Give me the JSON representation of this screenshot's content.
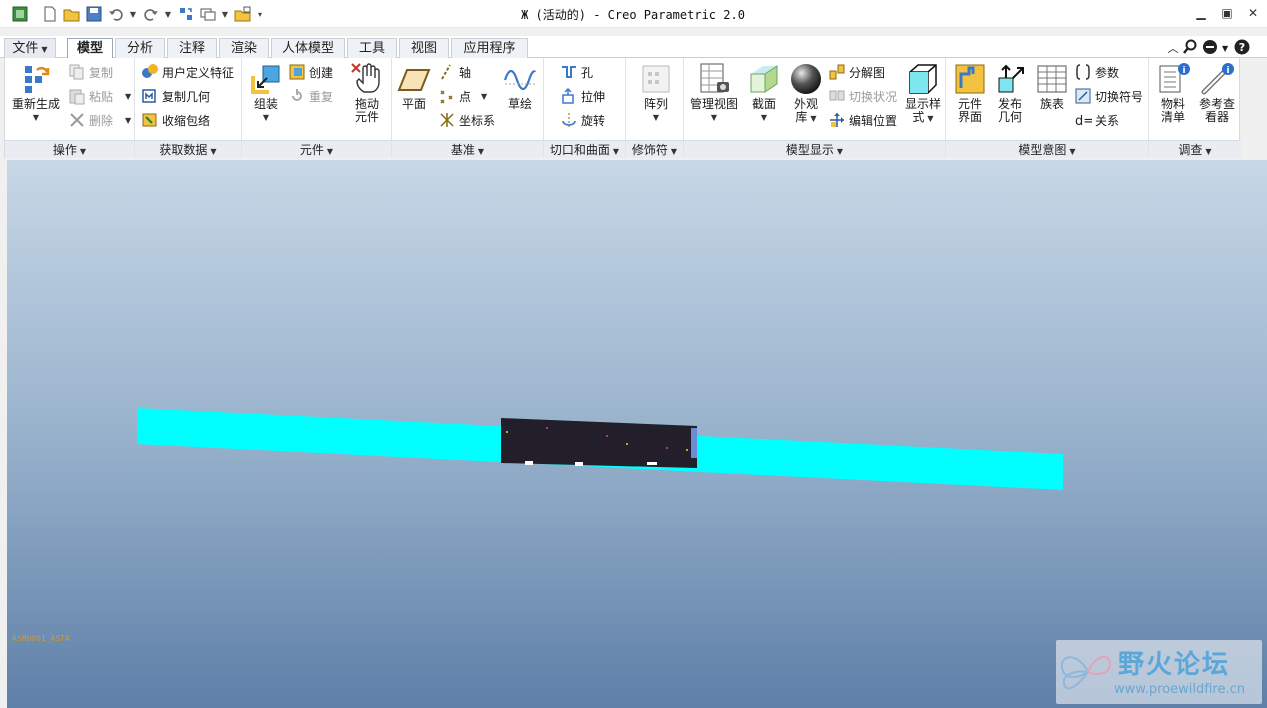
{
  "window": {
    "title": "Ж (活动的) - Creo Parametric 2.0",
    "controls": [
      "minimize",
      "restore",
      "close"
    ]
  },
  "quick_access": [
    "app-icon",
    "new-icon",
    "open-icon",
    "save-icon",
    "undo-icon",
    "redo-icon",
    "regenerate-icon",
    "windows-icon",
    "close-window-icon",
    "customize-icon"
  ],
  "tabs": [
    {
      "label": "文件",
      "dropdown": true
    },
    {
      "label": "模型",
      "active": true
    },
    {
      "label": "分析"
    },
    {
      "label": "注释"
    },
    {
      "label": "渲染"
    },
    {
      "label": "人体模型"
    },
    {
      "label": "工具"
    },
    {
      "label": "视图"
    },
    {
      "label": "应用程序"
    }
  ],
  "ribbon": {
    "groups": {
      "operations": {
        "label": "操作",
        "regenerate": "重新生成",
        "copy": "复制",
        "paste": "粘贴",
        "delete": "删除"
      },
      "get_data": {
        "label": "获取数据",
        "udf": "用户定义特征",
        "copy_geom": "复制几何",
        "shrinkwrap": "收缩包络"
      },
      "component": {
        "label": "元件",
        "assemble": "组装",
        "create": "创建",
        "repeat": "重复"
      },
      "drag": {
        "label": "拖动\n元件"
      },
      "datum": {
        "label": "基准",
        "plane": "平面",
        "axis": "轴",
        "point": "点",
        "csys": "坐标系",
        "sketch": "草绘"
      },
      "cut_surface": {
        "label": "切口和曲面",
        "hole": "孔",
        "extrude": "拉伸",
        "revolve": "旋转"
      },
      "modifiers": {
        "label": "修饰符",
        "pattern": "阵列"
      },
      "model_display": {
        "label": "模型显示",
        "manage_views": "管理视图",
        "section": "截面",
        "appearance_l1": "外观",
        "appearance_l2": "库",
        "explode": "分解图",
        "toggle_status": "切换状况",
        "edit_position": "编辑位置",
        "display_style_l1": "显示样",
        "display_style_l2": "式"
      },
      "model_intent": {
        "label": "模型意图",
        "interface_l1": "元件",
        "interface_l2": "界面",
        "publish_l1": "发布",
        "publish_l2": "几何",
        "family_table": "族表",
        "params": "参数",
        "switch_symbol": "切换符号",
        "relations": "关系"
      },
      "investigate": {
        "label": "调查",
        "bom_l1": "物料",
        "bom_l2": "清单",
        "ref_l1": "参考查",
        "ref_l2": "看器"
      }
    }
  },
  "viewport": {
    "coord_readout": "ASM0001_ASTA",
    "watermark_title": "野火论坛",
    "watermark_url": "www.proewildfire.cn",
    "colors": {
      "beam": "#00ffff",
      "component": "#231f2a"
    }
  }
}
